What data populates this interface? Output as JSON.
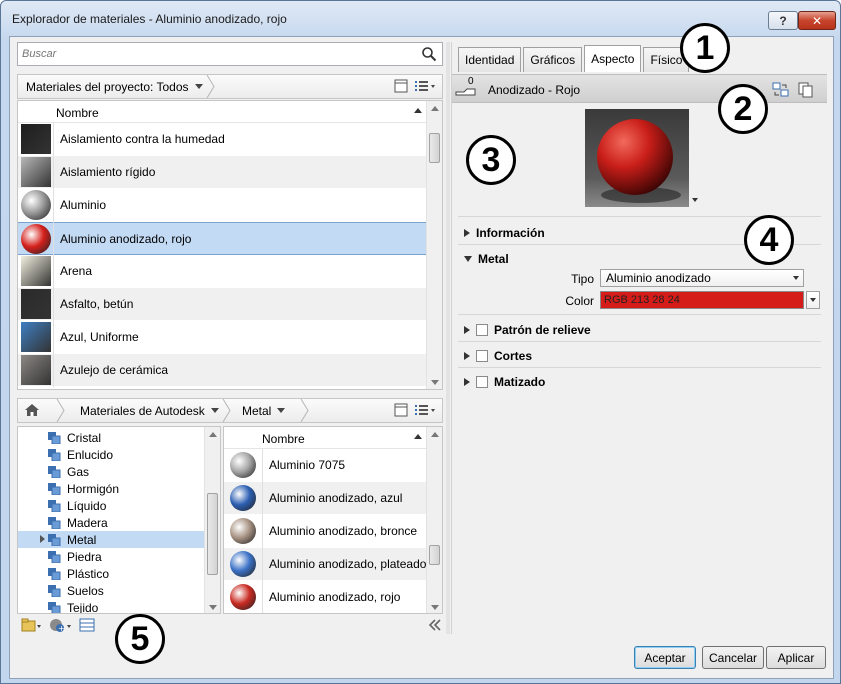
{
  "window": {
    "title": "Explorador de materiales - Aluminio anodizado, rojo",
    "help_label": "?",
    "close_label": "✕"
  },
  "search": {
    "placeholder": "Buscar"
  },
  "project": {
    "filter_label": "Materiales del proyecto: Todos",
    "column_header": "Nombre",
    "materials": [
      {
        "name": "Aislamiento contra la humedad",
        "thumb": "#1e1e1e"
      },
      {
        "name": "Aislamiento rígido",
        "thumb": "#b8b8b8"
      },
      {
        "name": "Aluminio",
        "thumb": "#9a9a9a"
      },
      {
        "name": "Aluminio anodizado, rojo",
        "thumb": "#d5201c"
      },
      {
        "name": "Arena",
        "thumb": "#f2f0e0"
      },
      {
        "name": "Asfalto, betún",
        "thumb": "#2a2a2a"
      },
      {
        "name": "Azul, Uniforme",
        "thumb": "#3f7fc3"
      },
      {
        "name": "Azulejo de cerámica",
        "thumb": "#8b8784"
      }
    ],
    "selected_index": 3
  },
  "library": {
    "breadcrumb_root": "Materiales de Autodesk",
    "breadcrumb_current": "Metal",
    "categories": [
      "Cristal",
      "Enlucido",
      "Gas",
      "Hormigón",
      "Líquido",
      "Madera",
      "Metal",
      "Piedra",
      "Plástico",
      "Suelos",
      "Tejido"
    ],
    "selected_category_index": 6,
    "column_header": "Nombre",
    "items": [
      {
        "name": "Aluminio 7075",
        "thumb": "#a6a6a6"
      },
      {
        "name": "Aluminio anodizado, azul",
        "thumb": "#2c5fb3"
      },
      {
        "name": "Aluminio anodizado, bronce",
        "thumb": "#a89384"
      },
      {
        "name": "Aluminio anodizado, plateado",
        "thumb": "#3c72c6"
      },
      {
        "name": "Aluminio anodizado, rojo",
        "thumb": "#c92a22"
      }
    ]
  },
  "tabs": [
    {
      "label": "Identidad",
      "active": false
    },
    {
      "label": "Gráficos",
      "active": false
    },
    {
      "label": "Aspecto",
      "active": true
    },
    {
      "label": "Físico",
      "active": false
    }
  ],
  "asset": {
    "name": "Anodizado - Rojo",
    "usage_count": "0"
  },
  "properties": {
    "info_label": "Información",
    "metal_label": "Metal",
    "type_label": "Tipo",
    "type_value": "Aluminio anodizado",
    "color_label": "Color",
    "color_value": "RGB 213 28 24",
    "color_hex": "#d51c18",
    "relief_label": "Patrón de relieve",
    "cuts_label": "Cortes",
    "tint_label": "Matizado"
  },
  "buttons": {
    "ok": "Aceptar",
    "cancel": "Cancelar",
    "apply": "Aplicar"
  },
  "callouts": [
    "1",
    "2",
    "3",
    "4",
    "5"
  ]
}
